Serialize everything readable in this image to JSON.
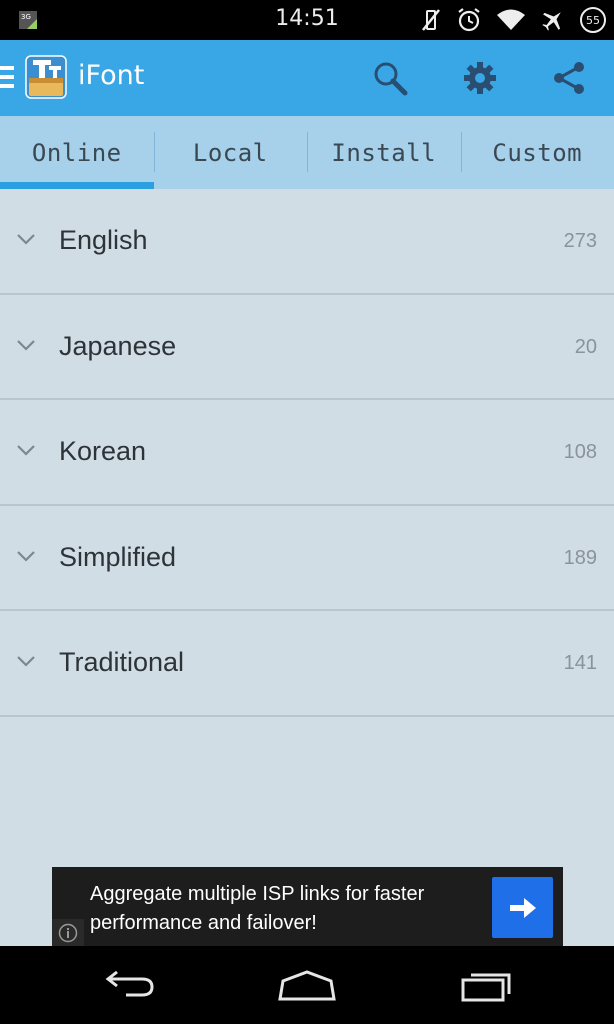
{
  "status_bar": {
    "time": "14:51",
    "battery_level": "55",
    "icons": [
      "3g-icon",
      "vibrate-off-icon",
      "alarm-icon",
      "wifi-icon",
      "airplane-icon",
      "battery-icon"
    ]
  },
  "action_bar": {
    "title": "iFont",
    "actions": [
      "search-icon",
      "settings-gear-icon",
      "share-icon"
    ]
  },
  "tabs": [
    {
      "label": "Online",
      "active": true
    },
    {
      "label": "Local",
      "active": false
    },
    {
      "label": "Install",
      "active": false
    },
    {
      "label": "Custom",
      "active": false
    }
  ],
  "categories": [
    {
      "label": "English",
      "count": "273"
    },
    {
      "label": "Japanese",
      "count": "20"
    },
    {
      "label": "Korean",
      "count": "108"
    },
    {
      "label": "Simplified",
      "count": "189"
    },
    {
      "label": "Traditional",
      "count": "141"
    }
  ],
  "ad": {
    "text": "Aggregate multiple ISP links for faster performance and failover!"
  },
  "colors": {
    "action_bar": "#39a7e6",
    "tabs_bg": "#a7d0eb",
    "tab_indicator": "#2c9fe0",
    "list_bg": "#d0dde5",
    "ad_button": "#1f6fe8"
  },
  "nav_bar": [
    "back-icon",
    "home-icon",
    "recents-icon"
  ]
}
